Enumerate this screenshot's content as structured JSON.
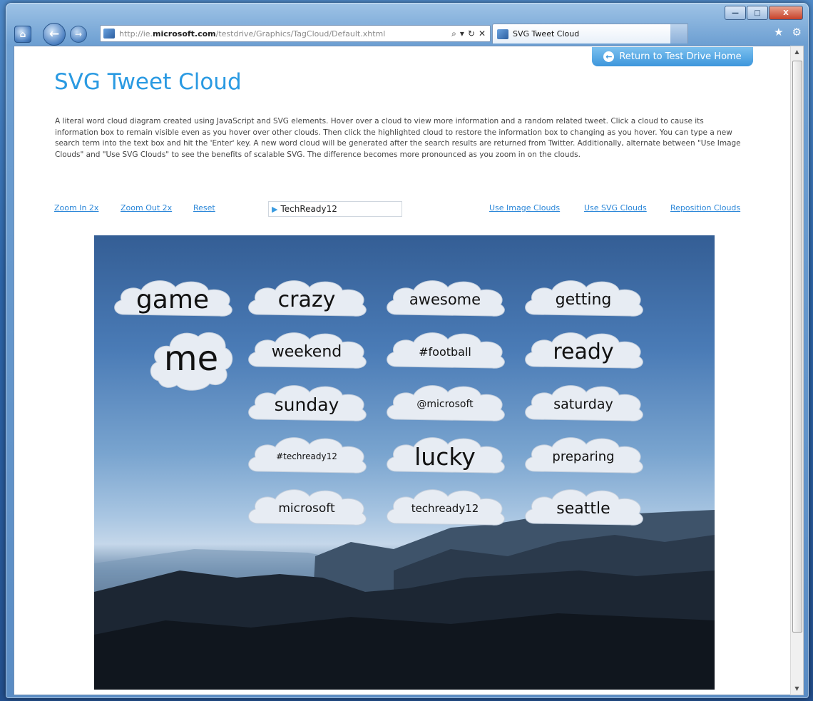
{
  "window": {
    "controls": {
      "minimize": "—",
      "maximize": "□",
      "close": "X"
    }
  },
  "browser": {
    "url_prefix": "http://ie.",
    "url_domain": "microsoft.com",
    "url_path": "/testdrive/Graphics/TagCloud/Default.xhtml",
    "address_actions": {
      "search": "⌕",
      "dropdown": "▾",
      "refresh": "↻",
      "stop": "✕"
    },
    "tab_title": "SVG Tweet Cloud",
    "tools": {
      "home": "⌂",
      "favorites": "★",
      "settings": "⚙"
    },
    "nav": {
      "back": "←",
      "forward": "→"
    }
  },
  "page": {
    "return_button": "Return to Test Drive Home",
    "return_icon": "←",
    "title": "SVG Tweet Cloud",
    "description": "A literal word cloud diagram created using JavaScript and SVG elements. Hover over a cloud to view more information and a random related tweet. Click a cloud to cause its information box to remain visible even as you hover over other clouds. Then click the highlighted cloud to restore the information box to changing as you hover. You can type a new search term into the text box and hit the 'Enter' key. A new word cloud will be generated after the search results are returned from Twitter. Additionally, alternate between \"Use Image Clouds\" and \"Use SVG Clouds\" to see the benefits of scalable SVG. The difference becomes more pronounced as you zoom in on the clouds.",
    "controls": {
      "zoom_in": "Zoom In 2x",
      "zoom_out": "Zoom Out 2x",
      "reset": "Reset",
      "search_value": "TechReady12",
      "search_icon": "twitter-bird-icon",
      "use_image": "Use Image Clouds",
      "use_svg": "Use SVG Clouds",
      "reposition": "Reposition Clouds"
    },
    "clouds": [
      "game",
      "crazy",
      "awesome",
      "getting",
      "me",
      "weekend",
      "#football",
      "ready",
      "sunday",
      "@microsoft",
      "saturday",
      "#techready12",
      "lucky",
      "preparing",
      "microsoft",
      "techready12",
      "seattle"
    ]
  },
  "colors": {
    "title_blue": "#2a9ae2",
    "link_blue": "#2a86d8",
    "return_button": "#3d96dc"
  }
}
